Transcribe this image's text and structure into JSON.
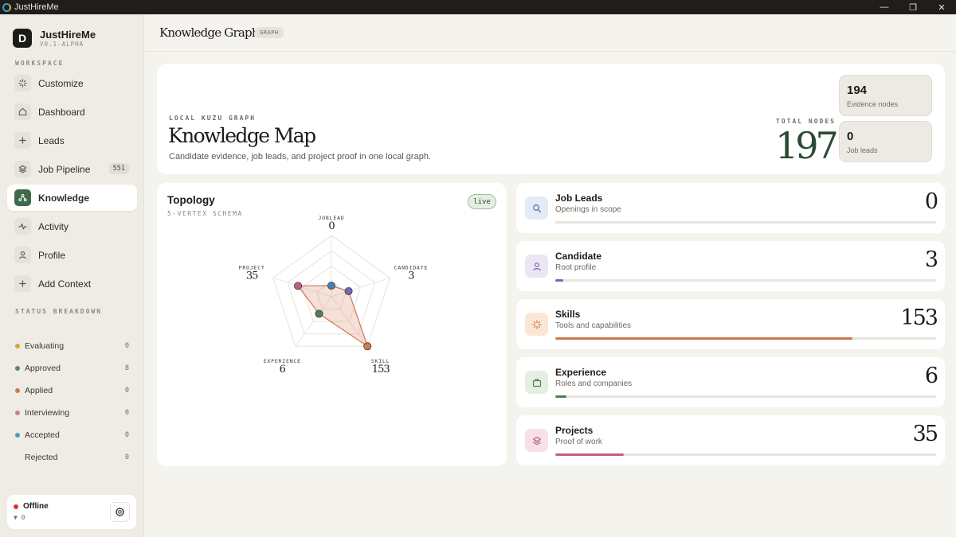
{
  "window": {
    "title": "JustHireMe"
  },
  "brand": {
    "name": "JustHireMe",
    "version": "V0.1-ALPHA",
    "logo_letter": "D"
  },
  "sidebar": {
    "workspace_label": "WORKSPACE",
    "items": [
      {
        "label": "Customize",
        "icon": "sparkle-icon"
      },
      {
        "label": "Dashboard",
        "icon": "home-icon"
      },
      {
        "label": "Leads",
        "icon": "plus-icon"
      },
      {
        "label": "Job Pipeline",
        "icon": "layers-icon",
        "count": "551"
      },
      {
        "label": "Knowledge",
        "icon": "graph-icon",
        "active": true
      },
      {
        "label": "Activity",
        "icon": "activity-icon"
      },
      {
        "label": "Profile",
        "icon": "user-icon"
      },
      {
        "label": "Add Context",
        "icon": "plus-icon"
      }
    ],
    "status_label": "STATUS BREAKDOWN",
    "statuses": [
      {
        "label": "Evaluating",
        "count": "0",
        "color": "#d4a83c"
      },
      {
        "label": "Approved",
        "count": "8",
        "color": "#5a8a5d"
      },
      {
        "label": "Applied",
        "count": "0",
        "color": "#d27b44"
      },
      {
        "label": "Interviewing",
        "count": "0",
        "color": "#c77ba3"
      },
      {
        "label": "Accepted",
        "count": "0",
        "color": "#4b9fb0"
      },
      {
        "label": "Rejected",
        "count": "0",
        "color": ""
      }
    ],
    "footer": {
      "status": "Offline",
      "count": "▼ 0"
    }
  },
  "header": {
    "title": "Knowledge Graph",
    "badge": "GRAPH"
  },
  "hero": {
    "eyebrow": "LOCAL KUZU GRAPH",
    "title": "Knowledge Map",
    "subtitle": "Candidate evidence, job leads, and project proof in one local graph.",
    "total_label": "TOTAL NODES",
    "total_value": "197",
    "stats": [
      {
        "value": "194",
        "label": "Evidence nodes"
      },
      {
        "value": "0",
        "label": "Job leads"
      }
    ]
  },
  "topology": {
    "title": "Topology",
    "subtitle": "5-VERTEX SCHEMA",
    "badge": "live",
    "vertices": [
      {
        "name": "JOBLEAD",
        "value": 0,
        "color": "#4a7fb5"
      },
      {
        "name": "CANDIDATE",
        "value": 3,
        "color": "#7566b3"
      },
      {
        "name": "SKILL",
        "value": 153,
        "color": "#d27b44"
      },
      {
        "name": "EXPERIENCE",
        "value": 6,
        "color": "#4f7f55"
      },
      {
        "name": "PROJECT",
        "value": 35,
        "color": "#c45d86"
      }
    ]
  },
  "metrics": [
    {
      "name": "Job Leads",
      "desc": "Openings in scope",
      "value": "0",
      "fraction": 0,
      "icon": "search-icon",
      "tint": "#e3ebf5",
      "fg": "#4a7fb5",
      "bar": "#4a7fb5"
    },
    {
      "name": "Candidate",
      "desc": "Root profile",
      "value": "3",
      "fraction": 0.02,
      "icon": "user-icon",
      "tint": "#ece6f3",
      "fg": "#7566b3",
      "bar": "#7566b3"
    },
    {
      "name": "Skills",
      "desc": "Tools and capabilities",
      "value": "153",
      "fraction": 0.78,
      "icon": "sparkle-icon",
      "tint": "#fbe6d6",
      "fg": "#d27b44",
      "bar": "#c97a4c"
    },
    {
      "name": "Experience",
      "desc": "Roles and companies",
      "value": "6",
      "fraction": 0.03,
      "icon": "briefcase-icon",
      "tint": "#e4efe1",
      "fg": "#4f7f55",
      "bar": "#4f7f55"
    },
    {
      "name": "Projects",
      "desc": "Proof of work",
      "value": "35",
      "fraction": 0.18,
      "icon": "layers-icon",
      "tint": "#f7e1e8",
      "fg": "#c45d86",
      "bar": "#c45d86"
    }
  ]
}
